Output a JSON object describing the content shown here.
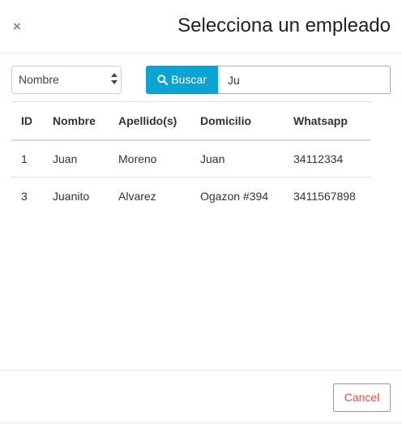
{
  "header": {
    "close_label": "×",
    "title": "Selecciona un empleado"
  },
  "search": {
    "field_select": {
      "selected": "Nombre"
    },
    "button_label": "Buscar",
    "button_icon": "search-icon",
    "query_value": "Ju"
  },
  "table": {
    "headers": [
      "ID",
      "Nombre",
      "Apellido(s)",
      "Domicilio",
      "Whatsapp"
    ],
    "rows": [
      [
        "1",
        "Juan",
        "Moreno",
        "Juan",
        "34112334"
      ],
      [
        "3",
        "Juanito",
        "Alvarez",
        "Ogazon #394",
        "3411567898"
      ]
    ]
  },
  "footer": {
    "cancel_label": "Cancel"
  },
  "colors": {
    "primary_button": "#0aa4d2",
    "cancel_text": "#d9534f",
    "cancel_border": "#e07b78",
    "input_focus_border": "#66c6e8"
  }
}
